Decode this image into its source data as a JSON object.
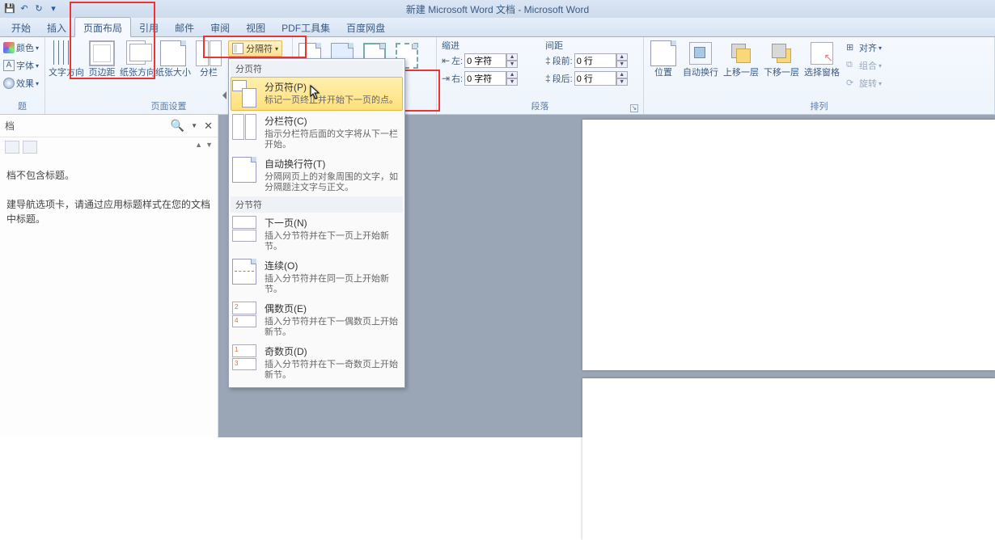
{
  "title": "新建 Microsoft Word 文档 - Microsoft Word",
  "tabs": {
    "start": "开始",
    "insert": "插入",
    "pageLayout": "页面布局",
    "reference": "引用",
    "mail": "邮件",
    "review": "审阅",
    "view": "视图",
    "pdf": "PDF工具集",
    "baidu": "百度网盘"
  },
  "themes": {
    "color": "颜色",
    "font": "字体",
    "effect": "效果",
    "groupLabel": "题"
  },
  "pageSetup": {
    "textDir": "文字方向",
    "margin": "页边距",
    "orient": "纸张方向",
    "size": "纸张大小",
    "columns": "分栏",
    "breaks": "分隔符",
    "groupLabel": "页面设置"
  },
  "pageBg": {
    "border": "页面边框"
  },
  "indent": {
    "header": "缩进",
    "left": "左:",
    "right": "右:",
    "leftVal": "0 字符",
    "rightVal": "0 字符"
  },
  "spacing": {
    "header": "间距",
    "before": "段前:",
    "after": "段后:",
    "beforeVal": "0 行",
    "afterVal": "0 行"
  },
  "para": {
    "groupLabel": "段落"
  },
  "arrange": {
    "position": "位置",
    "wrap": "自动换行",
    "front": "上移一层",
    "back": "下移一层",
    "selPane": "选择窗格",
    "align": "对齐",
    "group": "组合",
    "rotate": "旋转",
    "groupLabel": "排列"
  },
  "dropdown": {
    "section1": "分页符",
    "items1": [
      {
        "title": "分页符(P)",
        "desc": "标记一页终止并开始下一页的点。"
      },
      {
        "title": "分栏符(C)",
        "desc": "指示分栏符后面的文字将从下一栏开始。"
      },
      {
        "title": "自动换行符(T)",
        "desc": "分隔网页上的对象周围的文字，如分隔题注文字与正文。"
      }
    ],
    "section2": "分节符",
    "items2": [
      {
        "title": "下一页(N)",
        "desc": "插入分节符并在下一页上开始新节。"
      },
      {
        "title": "连续(O)",
        "desc": "插入分节符并在同一页上开始新节。"
      },
      {
        "title": "偶数页(E)",
        "desc": "插入分节符并在下一偶数页上开始新节。"
      },
      {
        "title": "奇数页(D)",
        "desc": "插入分节符并在下一奇数页上开始新节。"
      }
    ]
  },
  "navpane": {
    "placeholder": "档",
    "msg1": "档不包含标题。",
    "msg2": "建导航选项卡，请通过应用标题样式在您的文档中标题。"
  }
}
